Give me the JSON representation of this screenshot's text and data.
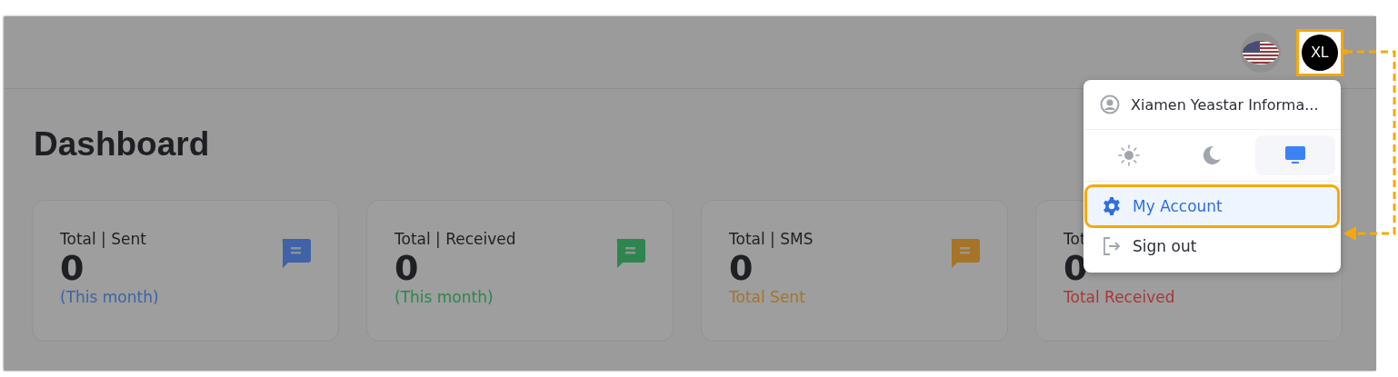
{
  "header": {
    "avatar": "XL"
  },
  "page": {
    "title": "Dashboard"
  },
  "cards": [
    {
      "title": "Total | Sent",
      "value": "0",
      "note": "(This month)",
      "color": "#3f63a6",
      "kind": "full"
    },
    {
      "title": "Total | Received",
      "value": "0",
      "note": "(This month)",
      "color": "#2f8550",
      "kind": "full"
    },
    {
      "title": "Total | SMS",
      "value": "0",
      "note": "Total Sent",
      "color": "#a67428",
      "kind": "full"
    },
    {
      "title": "Tot",
      "value": "0",
      "note": "Total Received",
      "color": "#a83838",
      "kind": "covered"
    }
  ],
  "menu": {
    "user": "Xiamen Yeastar Informa...",
    "themes": [
      {
        "kind": "light",
        "selected": false
      },
      {
        "kind": "dark",
        "selected": false
      },
      {
        "kind": "system",
        "selected": true
      }
    ],
    "items": [
      {
        "kind": "account",
        "label": "My Account",
        "selected": true
      },
      {
        "kind": "signout",
        "label": "Sign out",
        "selected": false
      }
    ]
  }
}
